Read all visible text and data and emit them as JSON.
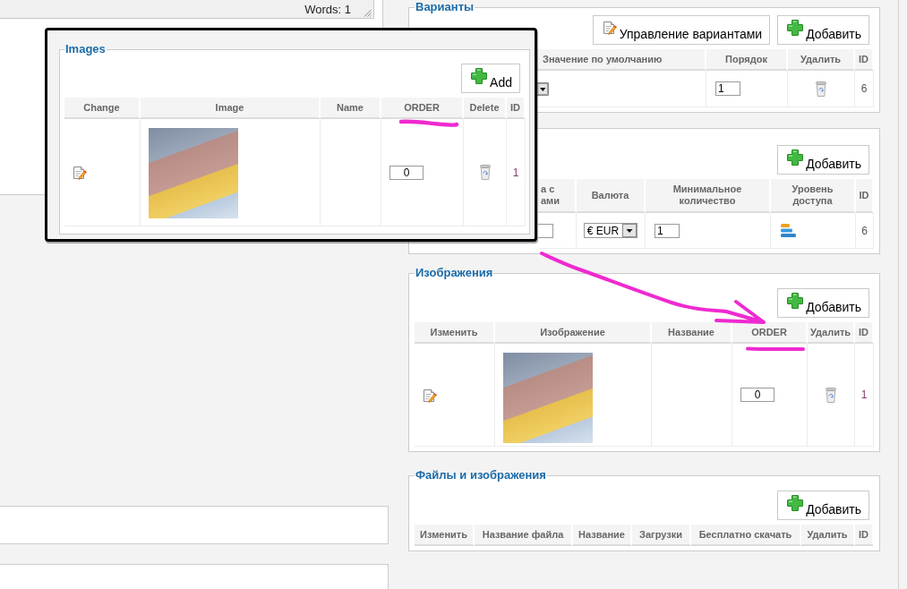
{
  "editor": {
    "status": "Words: 1"
  },
  "variants": {
    "title": "Варианты",
    "buttons": [
      {
        "kind": "manage",
        "label": "Управление вариантами"
      },
      {
        "kind": "add",
        "label": "Добавить"
      }
    ],
    "columns": [
      "Значение по умолчанию",
      "Порядок",
      "Удалить",
      "ID"
    ],
    "rows": [
      {
        "order": "1",
        "id": "6"
      }
    ]
  },
  "prices": {
    "buttons": [
      {
        "kind": "add",
        "label": "Добавить"
      }
    ],
    "columns": [
      "а с\nами",
      "Валюта",
      "Минимальное количество",
      "Уровень доступа",
      "ID"
    ],
    "rows": [
      {
        "currency": "€ EUR",
        "min_quantity": "1",
        "id": "6"
      }
    ]
  },
  "images": {
    "title": "Изображения",
    "buttons": [
      {
        "kind": "add",
        "label": "Добавить"
      }
    ],
    "columns": [
      "Изменить",
      "Изображение",
      "Название",
      "ORDER",
      "Удалить",
      "ID"
    ],
    "rows": [
      {
        "order": "0",
        "id": "1"
      }
    ]
  },
  "files": {
    "title": "Файлы и изображения",
    "buttons": [
      {
        "kind": "add",
        "label": "Добавить"
      }
    ],
    "columns": [
      "Изменить",
      "Название файла",
      "Название",
      "Загрузки",
      "Бесплатно скачать",
      "Удалить",
      "ID"
    ]
  },
  "popup": {
    "title": "Images",
    "buttons": [
      {
        "kind": "add",
        "label": "Add"
      }
    ],
    "columns": [
      "Change",
      "Image",
      "Name",
      "ORDER",
      "Delete",
      "ID"
    ],
    "rows": [
      {
        "order": "0",
        "id": "1"
      }
    ]
  }
}
